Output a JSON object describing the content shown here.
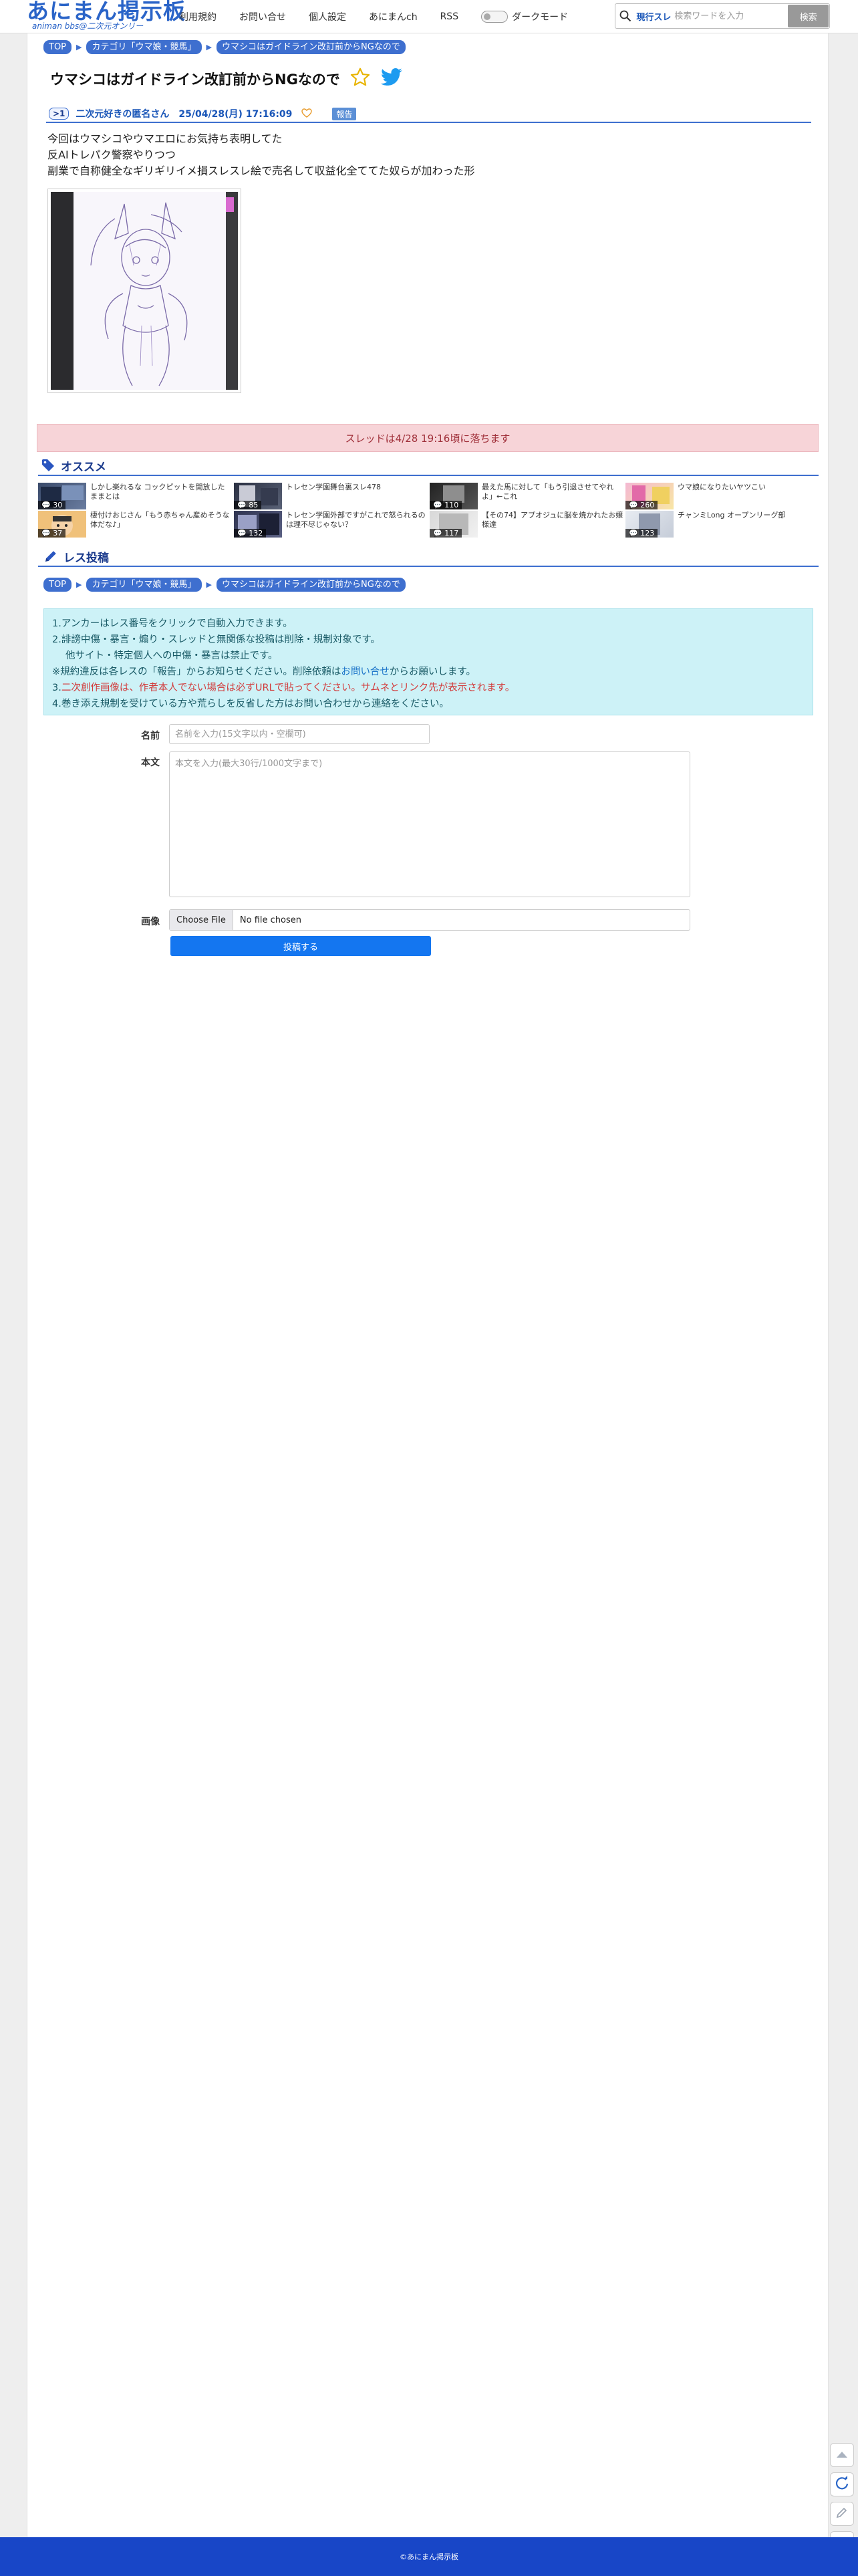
{
  "header": {
    "logo_main": "あにまん掲示板",
    "logo_sub": "animan bbs@二次元オンリー",
    "nav": [
      "利用規約",
      "お問い合せ",
      "個人設定",
      "あにまんch",
      "RSS"
    ],
    "dark_mode_label": "ダークモード",
    "search_scope": "現行スレ",
    "search_placeholder": "検索ワードを入力",
    "search_button": "検索"
  },
  "breadcrumb": [
    "TOP",
    "カテゴリ「ウマ娘・競馬」",
    "ウマシコはガイドライン改訂前からNGなので"
  ],
  "thread": {
    "title": "ウマシコはガイドライン改訂前からNGなので",
    "post": {
      "number": ">1",
      "name": "二次元好きの匿名さん",
      "date": "25/04/28(月) 17:16:09",
      "report_label": "報告",
      "lines": [
        "今回はウマシコやウマエロにお気持ち表明してた",
        "反AIトレパク警察やりつつ",
        "副業で自称健全なギリギリイメ損スレスレ絵で売名して収益化全ててた奴らが加わった形"
      ]
    }
  },
  "fall_notice": "スレッドは4/28 19:16頃に落ちます",
  "recommend": {
    "heading": "オススメ",
    "items": [
      {
        "title": "しかし楽れるな コックピットを開放したままとは",
        "count": "30"
      },
      {
        "title": "トレセン学園舞台裏スレ478",
        "count": "85"
      },
      {
        "title": "最えた馬に対して「もう引退させてやれよ」←これ",
        "count": "110"
      },
      {
        "title": "ウマ娘になりたいヤツこい",
        "count": "260"
      },
      {
        "title": "棲付けおじさん「もう赤ちゃん産めそうな体だな♪」",
        "count": "37"
      },
      {
        "title": "トレセン学園外部ですがこれで怒られるのは理不尽じゃない？",
        "count": "132"
      },
      {
        "title": "【その74】アプオジュに脳を焼かれたお嬢様達",
        "count": "117"
      },
      {
        "title": "チャンミLong オープンリーグ部",
        "count": "123"
      }
    ]
  },
  "reply": {
    "heading": "レス投稿",
    "rules": [
      "1.アンカーはレス番号をクリックで自動入力できます。",
      "2.誹謗中傷・暴言・煽り・スレッドと無関係な投稿は削除・規制対象です。",
      "他サイト・特定個人への中傷・暴言は禁止です。",
      "※規約違反は各レスの「報告」からお知らせください。削除依頼は",
      "お問い合せ",
      "からお願いします。",
      "3.",
      "二次創作画像は、作者本人でない場合は必ずURLで貼ってください。サムネとリンク先が表示されます。",
      "4.巻き添え規制を受けている方や荒らしを反省した方はお問い合わせから連絡をください。"
    ],
    "name_label": "名前",
    "name_placeholder": "名前を入力(15文字以内・空欄可)",
    "body_label": "本文",
    "body_placeholder": "本文を入力(最大30行/1000文字まで)",
    "image_label": "画像",
    "file_button": "Choose File",
    "file_status": "No file chosen",
    "submit": "投稿する"
  },
  "footer": "©あにまん掲示板",
  "colors": {
    "accent": "#3e6fcf",
    "footer": "#1846c7",
    "notice_bg": "#f7d4d8",
    "rules_bg": "#cdf2f7",
    "submit": "#1476f0"
  }
}
